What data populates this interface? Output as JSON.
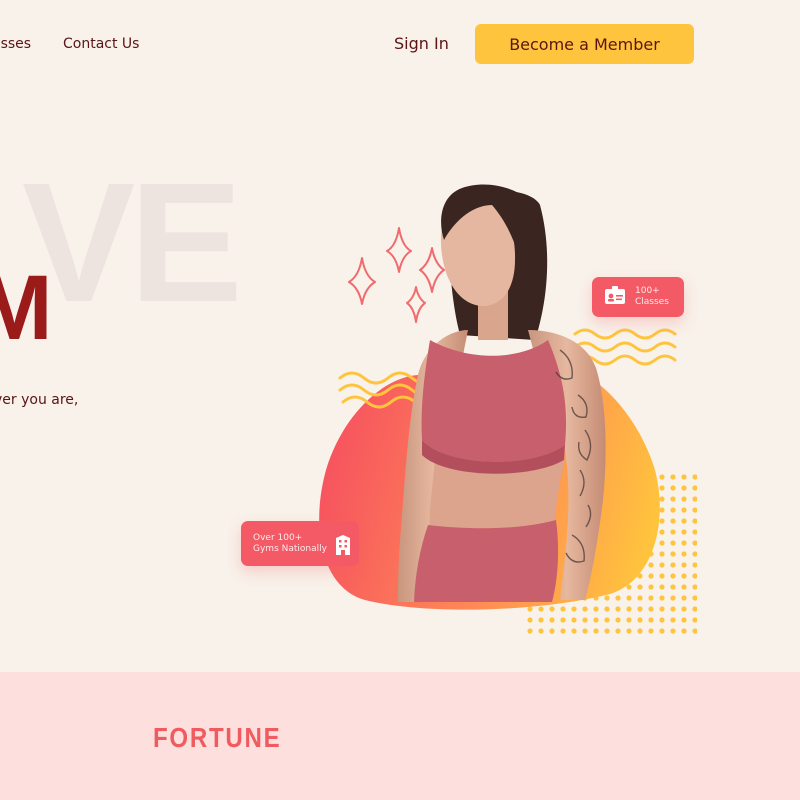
{
  "nav": {
    "items": [
      "asses",
      "Contact Us"
    ],
    "sign_in": "Sign In",
    "cta": "Become a Member"
  },
  "hero": {
    "background_word": "VE",
    "headline_fragment": "M",
    "subtext_fragment": "ver you are,",
    "cards": {
      "classes": {
        "line1": "100+",
        "line2": "Classes",
        "icon": "id-card-icon"
      },
      "gyms": {
        "line1": "Over 100+",
        "line2": "Gyms Nationally",
        "icon": "building-icon"
      }
    },
    "image": "woman-athlete-photo"
  },
  "logos": {
    "items": [
      "FORTUNE"
    ]
  },
  "colors": {
    "background": "#f8f2ea",
    "cta": "#ffc43d",
    "headline": "#9b1b1b",
    "card": "#f35a66",
    "logo_band": "#fddfdd",
    "blob_gradient": [
      "#f6525f",
      "#ffc43d"
    ]
  }
}
